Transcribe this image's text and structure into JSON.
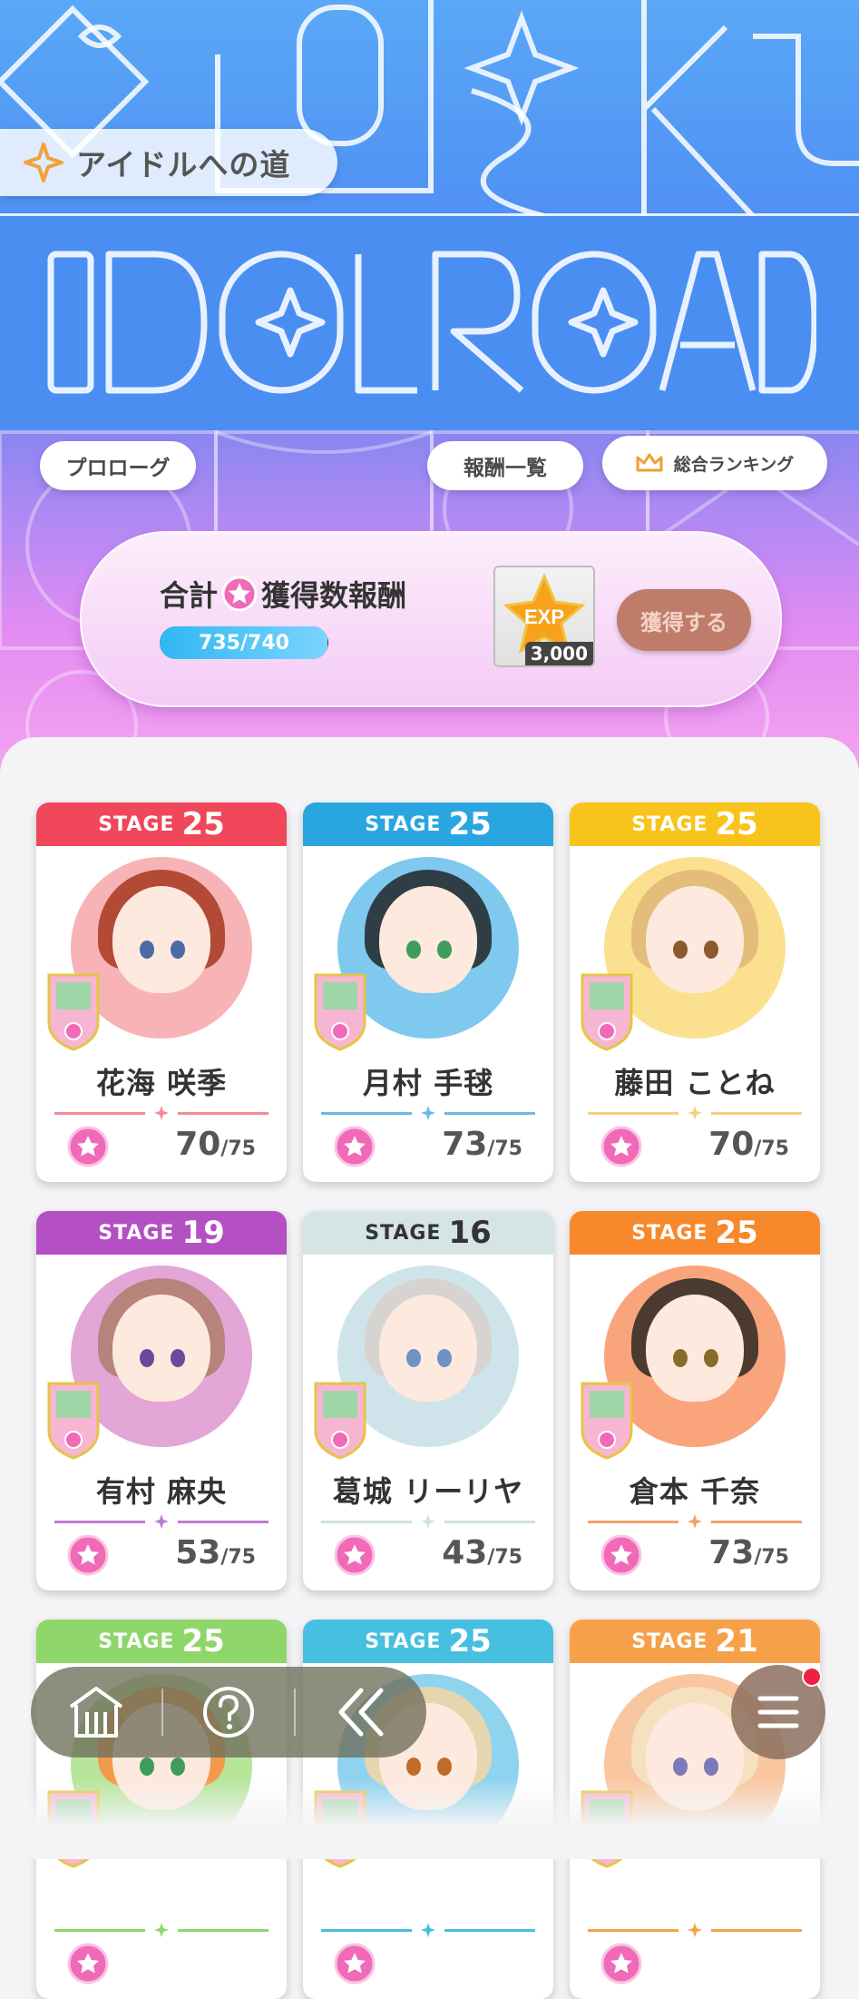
{
  "header": {
    "title": "アイドルへの道",
    "logo_text": "IDOLROAD",
    "prologue_label": "プロローグ",
    "rewards_list_label": "報酬一覧",
    "ranking_label": "総合ランキング"
  },
  "reward": {
    "title_prefix": "合計",
    "title_suffix": "獲得数報酬",
    "progress_text_current": "735",
    "progress_text_total": "/740",
    "progress_fraction": 0.993,
    "item_label": "EXP",
    "item_quantity": "3,000",
    "claim_label": "獲得する"
  },
  "stage_label": "STAGE",
  "score_max": "/75",
  "cards": [
    {
      "stage": "25",
      "name": "花海 咲季",
      "score": "70",
      "color": "#f0475a",
      "portrait_bg": "#f7b3b6",
      "hair": "#b24a35",
      "eye": "#4b6aa8",
      "line": "#f58b98"
    },
    {
      "stage": "25",
      "name": "月村 手毬",
      "score": "73",
      "color": "#29a6e0",
      "portrait_bg": "#7fc9ef",
      "hair": "#2f3d45",
      "eye": "#3f9c5a",
      "line": "#6ab8e6"
    },
    {
      "stage": "25",
      "name": "藤田 ことね",
      "score": "70",
      "color": "#f8c41b",
      "portrait_bg": "#fbe08f",
      "hair": "#e5bd7a",
      "eye": "#8a5a2c",
      "line": "#f5d27a"
    },
    {
      "stage": "19",
      "name": "有村 麻央",
      "score": "53",
      "color": "#b44fc4",
      "portrait_bg": "#e3a6d6",
      "hair": "#b8837a",
      "eye": "#6a4a9a",
      "line": "#c07ad0"
    },
    {
      "stage": "16",
      "name": "葛城 リーリヤ",
      "score": "43",
      "color": "#d5e4e4",
      "portrait_bg": "#cfe4ea",
      "hair": "#d7d3d0",
      "eye": "#6e92c4",
      "line": "#cfe0e6"
    },
    {
      "stage": "25",
      "name": "倉本 千奈",
      "score": "73",
      "color": "#f7892c",
      "portrait_bg": "#f9a47b",
      "hair": "#4b3a30",
      "eye": "#8a6a2c",
      "line": "#f5a06a"
    },
    {
      "stage": "25",
      "name": "",
      "score": "",
      "color": "#8fd66a",
      "portrait_bg": "#b7e59a",
      "hair": "#f29a4b",
      "eye": "#3f9c5a",
      "line": "#8fd66a"
    },
    {
      "stage": "25",
      "name": "",
      "score": "",
      "color": "#46bfe0",
      "portrait_bg": "#8fd3ef",
      "hair": "#e6d6b0",
      "eye": "#c06a2c",
      "line": "#46bfe0"
    },
    {
      "stage": "21",
      "name": "",
      "score": "",
      "color": "#f7a04a",
      "portrait_bg": "#f9c6a0",
      "hair": "#f5e0c0",
      "eye": "#7a7ab8",
      "line": "#f7a04a"
    }
  ],
  "nav": {
    "home_icon": "home-icon",
    "help_icon": "help-icon",
    "back_icon": "back-icon",
    "menu_icon": "menu-icon"
  }
}
